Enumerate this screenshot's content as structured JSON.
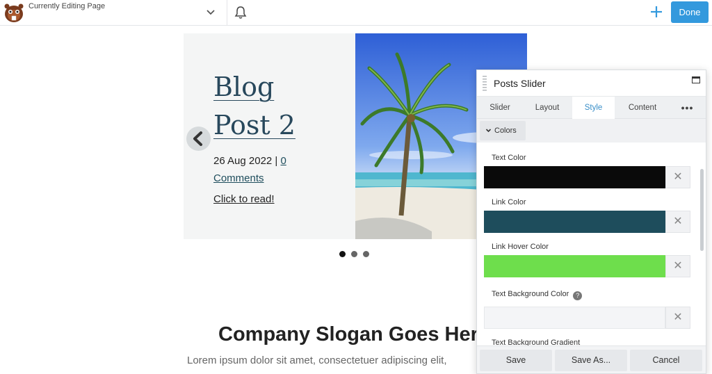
{
  "topbar": {
    "editing_label": "Currently Editing Page",
    "done_label": "Done",
    "icons": [
      "beaver-logo-icon",
      "chevron-down-icon",
      "bell-icon",
      "plus-icon"
    ],
    "accent_color": "#3399dd"
  },
  "slide": {
    "title_line1": "Blog",
    "title_line2": "Post 2",
    "date": "26 Aug 2022 | ",
    "comments_count": "0",
    "comments_label": "Comments",
    "cta": "Click to read!",
    "active_dot": 1,
    "dot_count": 3
  },
  "page": {
    "slogan": "Company Slogan Goes Her",
    "lorem": "Lorem ipsum dolor sit amet, consectetuer adipiscing elit,"
  },
  "panel": {
    "title": "Posts Slider",
    "tabs": [
      {
        "label": "Slider"
      },
      {
        "label": "Layout"
      },
      {
        "label": "Style"
      },
      {
        "label": "Content"
      },
      {
        "label": "•••"
      }
    ],
    "active_tab": "Style",
    "section_label": "Colors",
    "fields": {
      "text_color": {
        "label": "Text Color",
        "value": "#0a0a0a"
      },
      "link_color": {
        "label": "Link Color",
        "value": "#1e4d5c"
      },
      "link_hover_color": {
        "label": "Link Hover Color",
        "value": "#6ede4c"
      },
      "text_bg_color": {
        "label": "Text Background Color",
        "value": ""
      },
      "text_bg_gradient": {
        "label": "Text Background Gradient"
      }
    },
    "clear_glyph": "✕",
    "help_glyph": "?",
    "footer": {
      "save": "Save",
      "save_as": "Save As...",
      "cancel": "Cancel"
    }
  }
}
